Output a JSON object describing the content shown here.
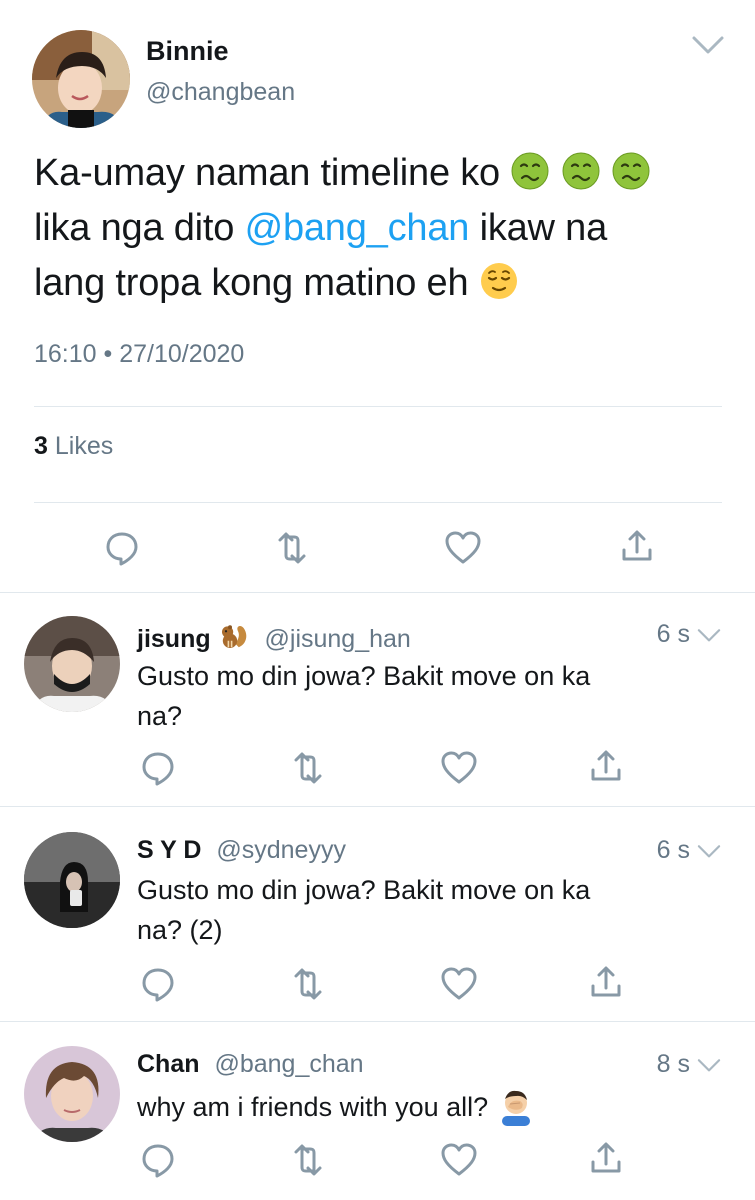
{
  "main_tweet": {
    "name": "Binnie",
    "handle": "@changbean",
    "text_line1": "Ka-umay naman timeline ko",
    "text_line2_pre": "lika nga dito",
    "text_mention": "@bang_chan",
    "text_line2_post": "ikaw na",
    "text_line3": "lang tropa kong matino eh",
    "emoji_line1": "nauseated-face-emoji x3",
    "emoji_line3": "relieved-face-emoji",
    "timestamp": "16:10 • 27/10/2020",
    "likes_count": "3",
    "likes_label": "Likes"
  },
  "replies": [
    {
      "name": "jisung",
      "name_emoji": "chipmunk-emoji",
      "handle": "@jisung_han",
      "time": "6 s",
      "line1": "Gusto mo din jowa? Bakit move on ka",
      "line2": "na?"
    },
    {
      "name": "S Y D",
      "handle": "@sydneyyy",
      "time": "6 s",
      "line1": "Gusto mo din jowa? Bakit move on ka",
      "line2": "na? (2)"
    },
    {
      "name": "Chan",
      "handle": "@bang_chan",
      "time": "8 s",
      "line1": "why am i friends with you all?",
      "line1_emoji": "facepalm-emoji"
    }
  ],
  "icons": {
    "reply": "reply-icon",
    "retweet": "retweet-icon",
    "like": "heart-icon",
    "share": "share-icon",
    "caret": "chevron-down-icon"
  },
  "colors": {
    "text": "#14171a",
    "secondary": "#657786",
    "mention": "#1da1f2",
    "divider": "#e1e8ed",
    "icon": "#8899a6"
  }
}
